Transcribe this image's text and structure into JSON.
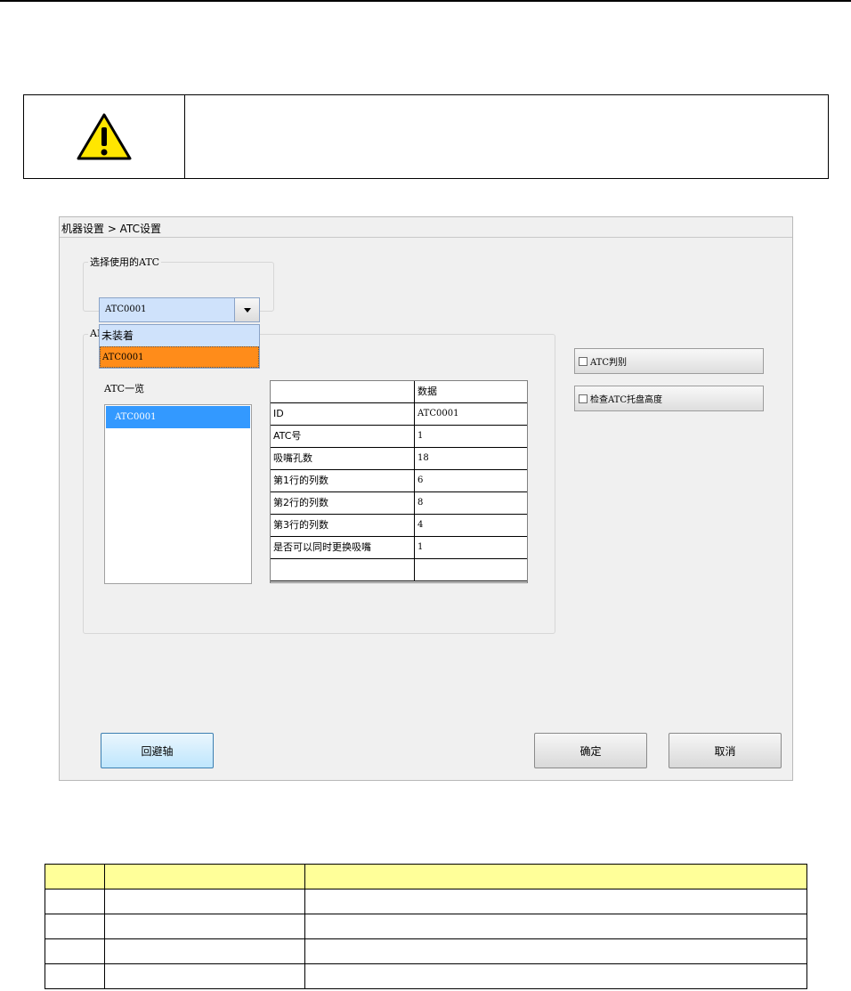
{
  "dialog": {
    "breadcrumb": "机器设置 > ATC设置",
    "select_group_label": "选择使用的ATC",
    "combo_value": "ATC0001",
    "dropdown_options": [
      "未装着",
      "ATC0001"
    ],
    "dropdown_selected": "ATC0001",
    "info_group_label_visible": "AI",
    "list_label": "ATC一览",
    "list_items": [
      "ATC0001"
    ],
    "grid": {
      "header": [
        "",
        "数据"
      ],
      "rows": [
        [
          "ID",
          "ATC0001"
        ],
        [
          "ATC号",
          "1"
        ],
        [
          "吸嘴孔数",
          "18"
        ],
        [
          "第1行的列数",
          "6"
        ],
        [
          "第2行的列数",
          "8"
        ],
        [
          "第3行的列数",
          "4"
        ],
        [
          "是否可以同时更换吸嘴",
          "1"
        ],
        [
          "",
          ""
        ]
      ]
    },
    "checkboxes": [
      {
        "label": "ATC判别",
        "checked": false
      },
      {
        "label": "检查ATC托盘高度",
        "checked": false
      }
    ],
    "buttons": {
      "retract": "回避轴",
      "ok": "确定",
      "cancel": "取消"
    }
  },
  "colors": {
    "selection_blue": "#3399ff",
    "dropdown_highlight": "#ff8c1a",
    "table_header_yellow": "#ffff99",
    "warning_yellow": "#ffe600"
  }
}
